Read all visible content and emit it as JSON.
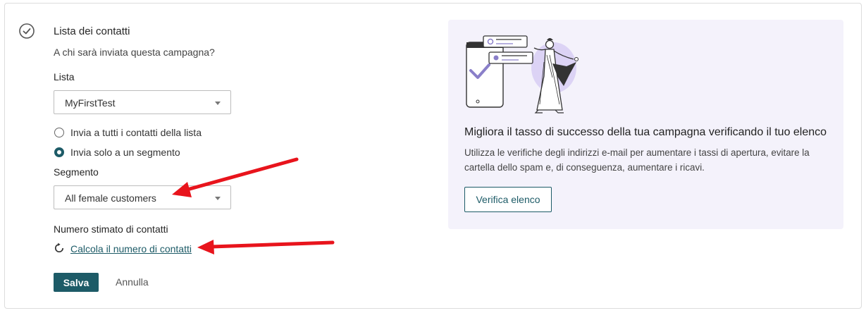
{
  "section": {
    "title": "Lista dei contatti",
    "subtitle": "A chi sarà inviata questa campagna?"
  },
  "list": {
    "label": "Lista",
    "selected": "MyFirstTest"
  },
  "send_options": [
    {
      "label": "Invia a tutti i contatti della lista",
      "selected": false
    },
    {
      "label": "Invia solo a un segmento",
      "selected": true
    }
  ],
  "segment": {
    "label": "Segmento",
    "selected": "All female customers"
  },
  "estimate": {
    "label": "Numero stimato di contatti",
    "link": "Calcola il numero di contatti"
  },
  "actions": {
    "save": "Salva",
    "cancel": "Annulla"
  },
  "promo": {
    "title": "Migliora il tasso di successo della tua campagna verificando il tuo elenco",
    "text": "Utilizza le verifiche degli indirizzi e-mail per aumentare i tassi di apertura, evitare la cartella dello spam e, di conseguenza, aumentare i ricavi.",
    "button": "Verifica elenco"
  },
  "colors": {
    "accent": "#1d5b67",
    "promo_bg": "#f4f2fb",
    "annotation_arrow": "#e8141c"
  },
  "icons": [
    "check-circle-icon",
    "refresh-icon",
    "chevron-down-icon"
  ]
}
